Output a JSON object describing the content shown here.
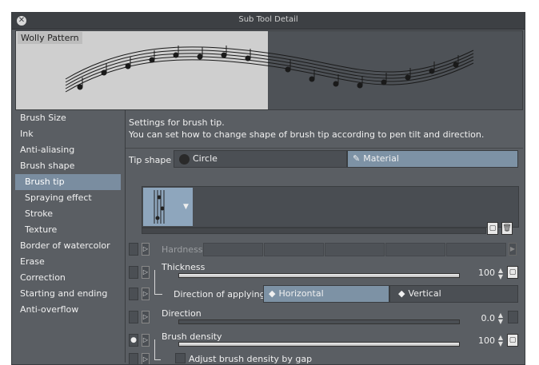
{
  "window": {
    "title": "Sub Tool Detail"
  },
  "preview": {
    "label": "Wolly Pattern"
  },
  "sidebar": {
    "items": [
      {
        "label": "Brush Size"
      },
      {
        "label": "Ink"
      },
      {
        "label": "Anti-aliasing"
      },
      {
        "label": "Brush shape"
      },
      {
        "label": "Brush tip"
      },
      {
        "label": "Spraying effect"
      },
      {
        "label": "Stroke"
      },
      {
        "label": "Texture"
      },
      {
        "label": "Border of watercolor"
      },
      {
        "label": "Erase"
      },
      {
        "label": "Correction"
      },
      {
        "label": "Starting and ending"
      },
      {
        "label": "Anti-overflow"
      }
    ],
    "selected": "Brush tip"
  },
  "main": {
    "desc_line1": "Settings for brush tip.",
    "desc_line2": "You can set how to change shape of brush tip according to pen tilt and direction.",
    "tip_shape": {
      "label": "Tip shape",
      "option_circle": "Circle",
      "option_material": "Material",
      "selected": "Material"
    },
    "hardness": {
      "label": "Hardness"
    },
    "thickness": {
      "label": "Thickness",
      "value": "100",
      "level": 1.0
    },
    "direction_of_applying": {
      "label": "Direction of applying",
      "option_horizontal": "Horizontal",
      "option_vertical": "Vertical",
      "selected": "Horizontal"
    },
    "direction": {
      "label": "Direction",
      "value": "0.0",
      "level": 0.0
    },
    "brush_density": {
      "label": "Brush density",
      "value": "100",
      "level": 1.0
    },
    "adjust_density": {
      "label": "Adjust brush density by gap"
    }
  },
  "colors": {
    "accent": "#7d92a5",
    "panel": "#5a5e63",
    "titlebar": "#3d4044"
  }
}
